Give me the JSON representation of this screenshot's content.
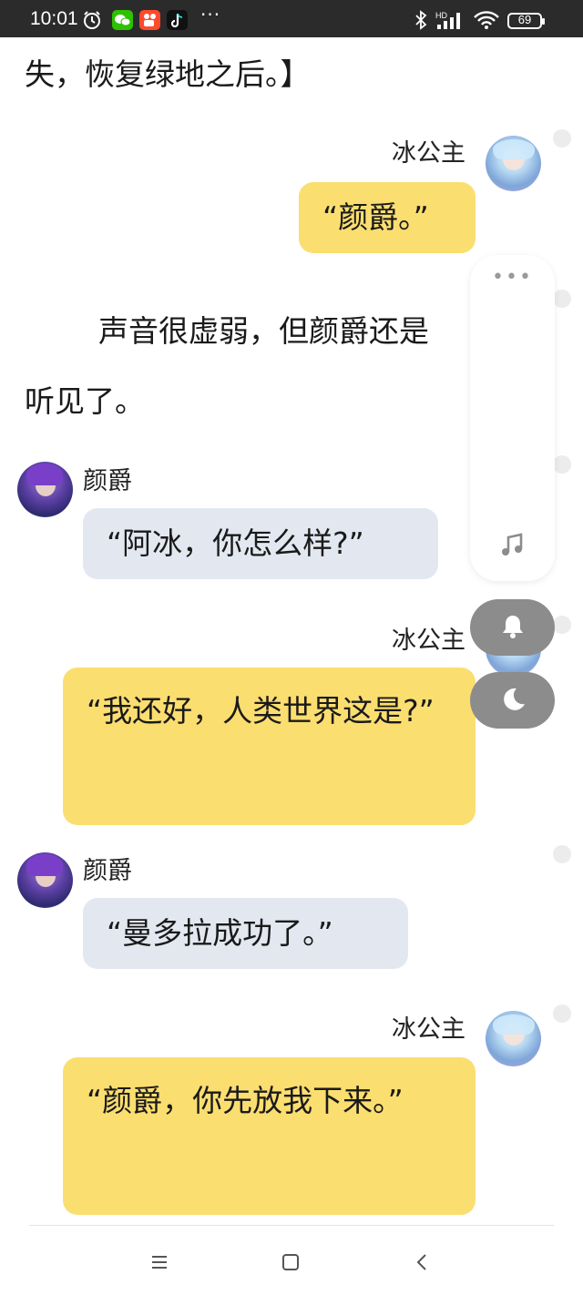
{
  "status_bar": {
    "time": "10:01",
    "icons": [
      "alarm-icon",
      "wechat-icon",
      "kuaishou-icon",
      "tiktok-icon",
      "more-icon",
      "bluetooth-icon",
      "hd-signal-icon",
      "wifi-icon"
    ],
    "network_label": "HD",
    "battery": "69",
    "more": "···"
  },
  "content": {
    "para_top": "失，恢复绿地之后。】",
    "para_mid_line1": "声音很虚弱，但颜爵还是",
    "para_mid_line2": "听见了。",
    "messages": [
      {
        "speaker": "冰公主",
        "text": "“颜爵。”"
      },
      {
        "speaker": "颜爵",
        "text": "“阿冰，你怎么样?”"
      },
      {
        "speaker": "冰公主",
        "text": "“我还好，人类世界这是?”"
      },
      {
        "speaker": "颜爵",
        "text": "“曼多拉成功了。”"
      },
      {
        "speaker": "冰公主",
        "text": "“颜爵，你先放我下来。”"
      }
    ]
  },
  "float_panel": {
    "more": "•••",
    "icons": [
      "more-icon",
      "music-icon",
      "bell-icon",
      "moon-icon"
    ]
  },
  "nav_bar": {
    "icons": [
      "menu-icon",
      "home-icon",
      "back-icon"
    ]
  },
  "colors": {
    "status_bg": "#2b2b2b",
    "bubble_self": "#fbde70",
    "bubble_other": "#e3e8f0",
    "float_button": "#8c8c8c"
  }
}
